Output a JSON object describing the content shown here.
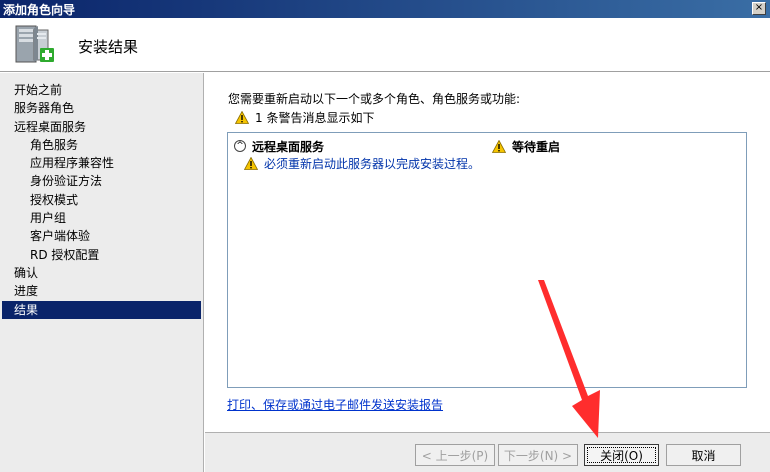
{
  "window": {
    "title": "添加角色向导",
    "close_label": "×"
  },
  "header": {
    "title": "安装结果"
  },
  "nav": {
    "items": [
      {
        "label": "开始之前",
        "sub": false,
        "active": false
      },
      {
        "label": "服务器角色",
        "sub": false,
        "active": false
      },
      {
        "label": "远程桌面服务",
        "sub": false,
        "active": false
      },
      {
        "label": "角色服务",
        "sub": true,
        "active": false
      },
      {
        "label": "应用程序兼容性",
        "sub": true,
        "active": false
      },
      {
        "label": "身份验证方法",
        "sub": true,
        "active": false
      },
      {
        "label": "授权模式",
        "sub": true,
        "active": false
      },
      {
        "label": "用户组",
        "sub": true,
        "active": false
      },
      {
        "label": "客户端体验",
        "sub": true,
        "active": false
      },
      {
        "label": "RD 授权配置",
        "sub": true,
        "active": false
      },
      {
        "label": "确认",
        "sub": false,
        "active": false
      },
      {
        "label": "进度",
        "sub": false,
        "active": false
      },
      {
        "label": "结果",
        "sub": false,
        "active": true
      }
    ]
  },
  "main": {
    "intro": "您需要重新启动以下一个或多个角色、角色服务或功能:",
    "warning_count": "1 条警告消息显示如下",
    "results": {
      "role": "远程桌面服务",
      "status": "等待重启",
      "message": "必须重新启动此服务器以完成安装过程。"
    },
    "report_link": "打印、保存或通过电子邮件发送安装报告"
  },
  "buttons": {
    "prev": "< 上一步(P)",
    "next": "下一步(N) >",
    "close": "关闭(O)",
    "cancel": "取消"
  },
  "colors": {
    "accent": "#0a246a",
    "link": "#0033cc",
    "warning": "#f5c400",
    "arrow": "#ff2d2d"
  }
}
